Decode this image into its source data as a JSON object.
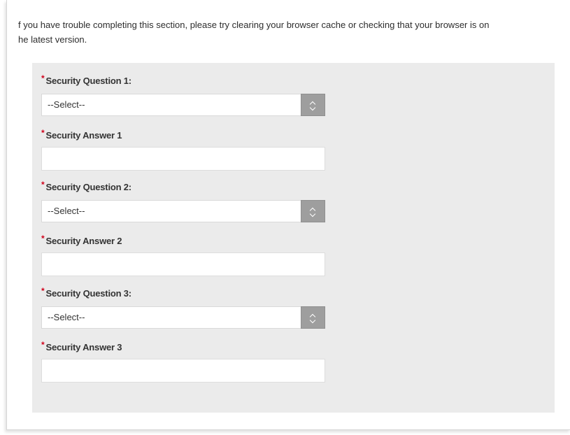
{
  "intro": {
    "line1": "f you have trouble completing this section, please try clearing your browser cache or checking that your browser is on",
    "line2": "he latest version."
  },
  "form": {
    "required_marker": "*",
    "question1": {
      "label": "Security Question 1:",
      "value": "--Select--"
    },
    "answer1": {
      "label": "Security Answer 1",
      "value": ""
    },
    "question2": {
      "label": "Security Question 2:",
      "value": "--Select--"
    },
    "answer2": {
      "label": "Security Answer 2",
      "value": ""
    },
    "question3": {
      "label": "Security Question 3:",
      "value": "--Select--"
    },
    "answer3": {
      "label": "Security Answer 3",
      "value": ""
    }
  },
  "icons": {
    "select_toggle": "chevron-up-down-icon",
    "required": "asterisk"
  },
  "colors": {
    "panel_background": "#ebebeb",
    "required_marker": "#d0021b",
    "select_button": "#9e9e9e"
  }
}
